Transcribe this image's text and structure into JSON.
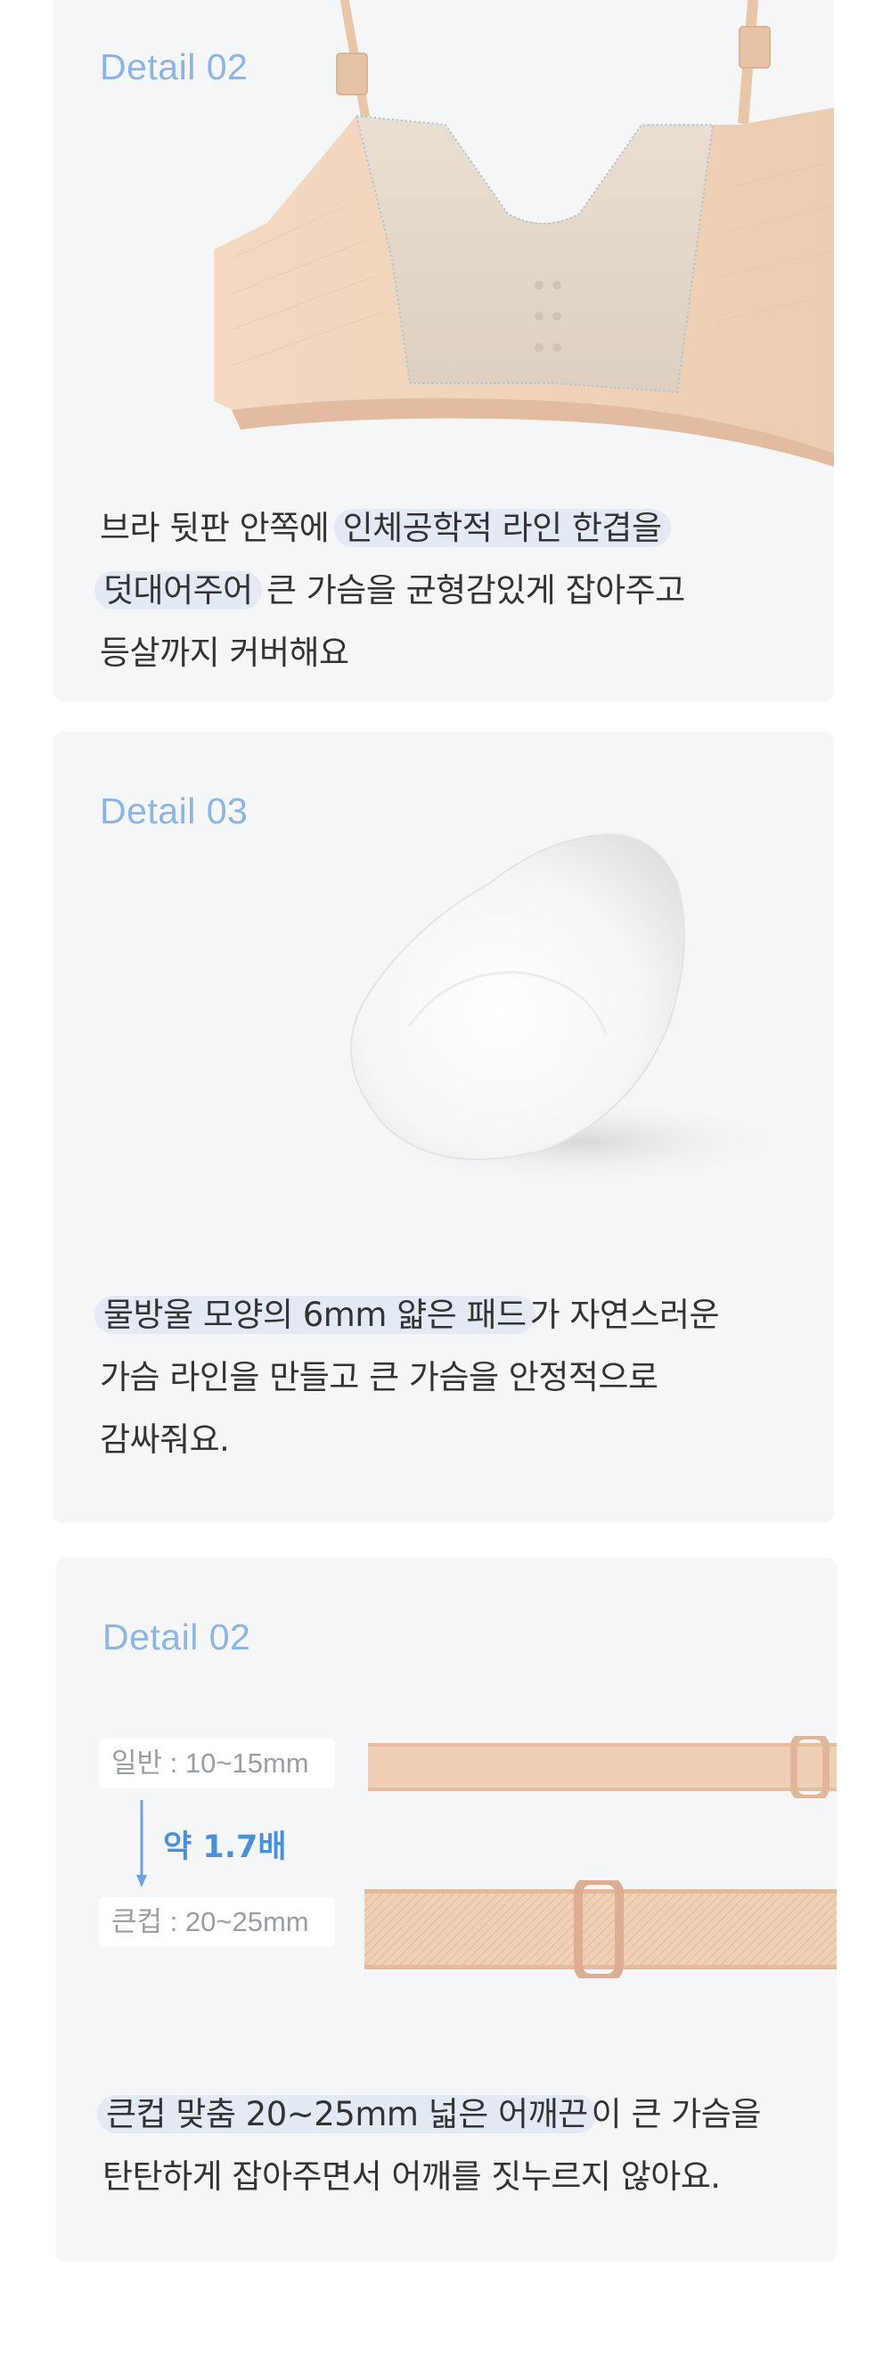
{
  "section1": {
    "label": "Detail 02",
    "line1_pre": "브라 뒷판 안쪽에 ",
    "line1_hl": "인체공학적 라인 한겹을",
    "line2_hl": "덧대어주어",
    "line2_post": " 큰 가슴을 균형감있게 잡아주고",
    "line3": "등살까지 커버해요"
  },
  "section2": {
    "label": "Detail 03",
    "line1_hl": "물방울 모양의 6mm 얇은 패드",
    "line1_post": "가 자연스러운",
    "line2": "가슴 라인을 만들고 큰 가슴을 안정적으로",
    "line3": "감싸줘요."
  },
  "section3": {
    "label": "Detail 02",
    "normal_width": "일반 : 10~15mm",
    "big_width": "큰컵 : 20~25mm",
    "ratio": "약 1.7배",
    "line1_hl": "큰컵 맞춤 20~25mm 넓은 어깨끈",
    "line1_post": "이 큰 가슴을",
    "line2": "탄탄하게 잡아주면서 어깨를 짓누르지 않아요."
  },
  "colors": {
    "card_bg": "#f5f6f8",
    "label": "#8bb5e3",
    "highlight": "#e3eaf3",
    "accent": "#4a90d9",
    "skin": "#f0d2b8"
  }
}
